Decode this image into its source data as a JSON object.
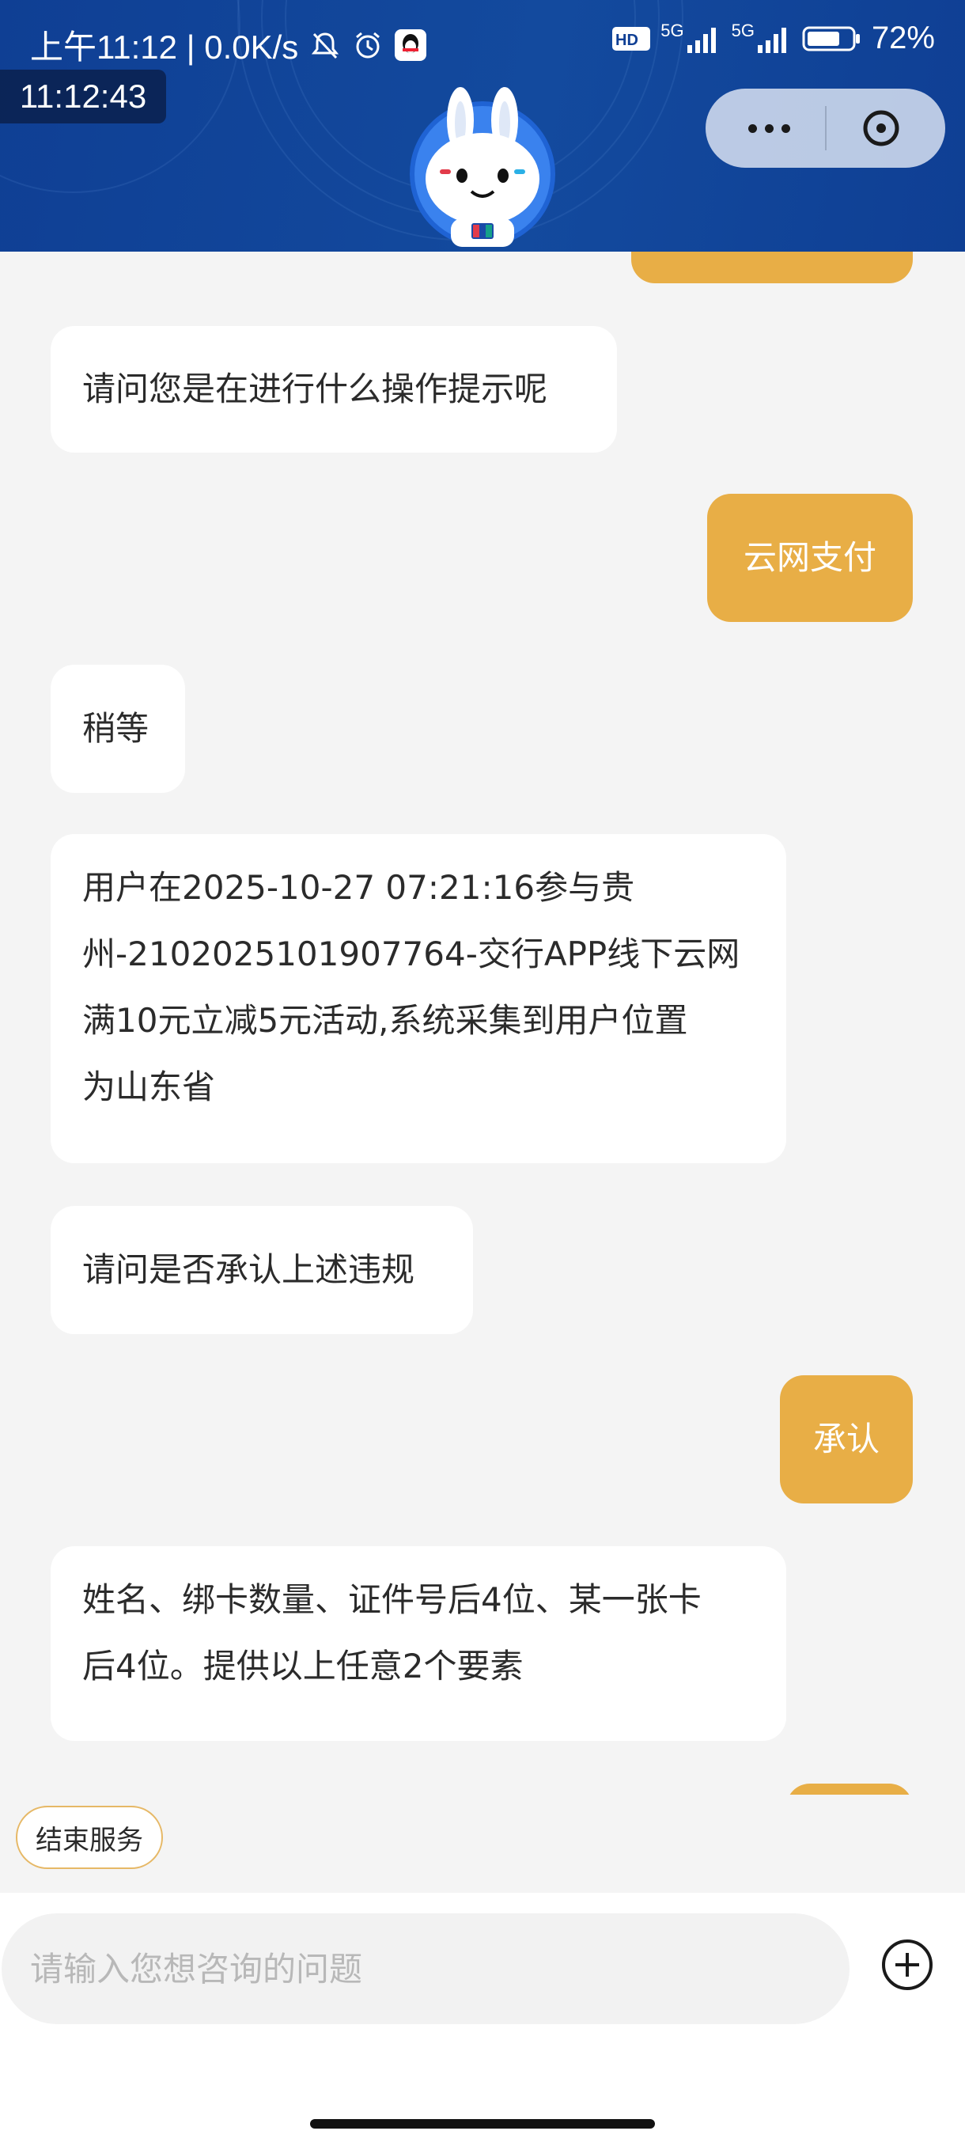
{
  "status_bar": {
    "left_text": "上午11:12 | 0.0K/s",
    "net_type_1": "5G",
    "net_type_2": "5G",
    "battery": "72%",
    "hd_label": "HD"
  },
  "time_overlay": "11:12:43",
  "capsule": {
    "more_icon": "more-dots-icon",
    "close_icon": "close-circle-icon"
  },
  "colors": {
    "header_blue": "#0f3f94",
    "user_bubble": "#e8ae46",
    "agent_bubble": "#ffffff",
    "chat_bg": "#f4f4f4"
  },
  "messages": [
    {
      "role": "agent",
      "text": "请问您是在进行什么操作提示呢"
    },
    {
      "role": "user",
      "text": "云网支付"
    },
    {
      "role": "agent",
      "text": "稍等"
    },
    {
      "role": "agent",
      "lines": [
        "用户在2025-10-27 07:21:16参与贵",
        "州-2102025101907764-交行APP线下云网",
        "满10元立减5元活动,系统采集到用户位置",
        "为山东省"
      ]
    },
    {
      "role": "agent",
      "text": "请问是否承认上述违规"
    },
    {
      "role": "user",
      "text": "承认"
    },
    {
      "role": "agent",
      "lines": [
        "姓名、绑卡数量、证件号后4位、某一张卡",
        "后4位。提供以上任意2个要素"
      ]
    }
  ],
  "end_service": "结束服务",
  "input": {
    "placeholder": "请输入您想咨询的问题",
    "value": ""
  },
  "add_icon": "plus-circle-icon"
}
